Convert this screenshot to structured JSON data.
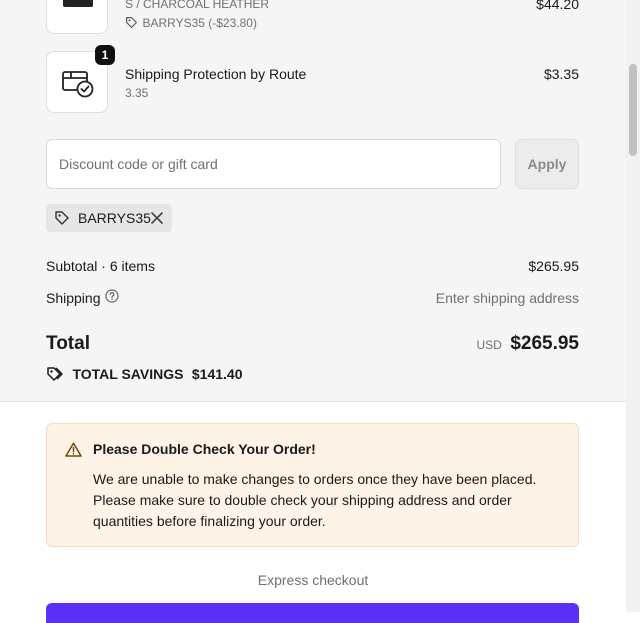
{
  "line_items": [
    {
      "variant": "S / CHARCOAL HEATHER",
      "discount_note": "BARRYS35 (-$23.80)",
      "price": "$44.20",
      "image_icon": "shirt-image"
    },
    {
      "title": "Shipping Protection by Route",
      "subtitle": "3.35",
      "price": "$3.35",
      "quantity": "1",
      "image_icon": "package-check-icon"
    }
  ],
  "discount": {
    "placeholder": "Discount code or gift card",
    "value": "",
    "apply_label": "Apply",
    "applied_code": "BARRYS35"
  },
  "totals": {
    "subtotal_label": "Subtotal · 6 items",
    "subtotal_value": "$265.95",
    "shipping_label": "Shipping",
    "shipping_value": "Enter shipping address",
    "total_label": "Total",
    "currency": "USD",
    "total_value": "$265.95",
    "savings_label": "TOTAL SAVINGS",
    "savings_value": "$141.40"
  },
  "notice": {
    "title": "Please Double Check Your Order!",
    "body": "We are unable to make changes to orders once they have been placed. Please make sure to double check your shipping address and order quantities before finalizing your order."
  },
  "express": {
    "label": "Express checkout",
    "button_color": "#5a31f4"
  },
  "colors": {
    "summary_bg": "#f5f5f5",
    "notice_bg": "#fdf3e6",
    "accent": "#5a31f4"
  }
}
